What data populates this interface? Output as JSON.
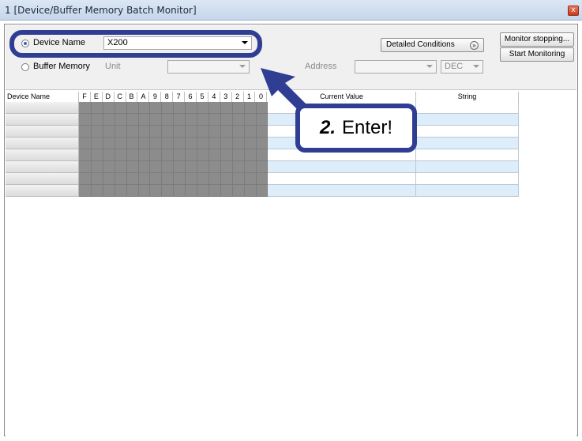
{
  "window": {
    "title": "1 [Device/Buffer Memory Batch Monitor]",
    "close_glyph": "x"
  },
  "controls": {
    "device_name_label": "Device Name",
    "device_name_value": "X200",
    "buffer_memory_label": "Buffer Memory",
    "unit_label": "Unit",
    "unit_value": "",
    "address_label": "Address",
    "address_value": "",
    "format_value": "DEC",
    "detailed_conditions_label": "Detailed Conditions",
    "monitor_stopping_label": "Monitor stopping...",
    "start_monitoring_label": "Start Monitoring"
  },
  "table": {
    "headers": {
      "device_name": "Device Name",
      "bits": [
        "F",
        "E",
        "D",
        "C",
        "B",
        "A",
        "9",
        "8",
        "7",
        "6",
        "5",
        "4",
        "3",
        "2",
        "1",
        "0"
      ],
      "current_value": "Current Value",
      "string": "String"
    },
    "row_count": 8
  },
  "annotation": {
    "step_number": "2.",
    "step_text": "Enter!",
    "color": "#2f3d93"
  },
  "colors": {
    "bit_area": "#8c8c8c",
    "alt_row": "#ddeefa"
  }
}
